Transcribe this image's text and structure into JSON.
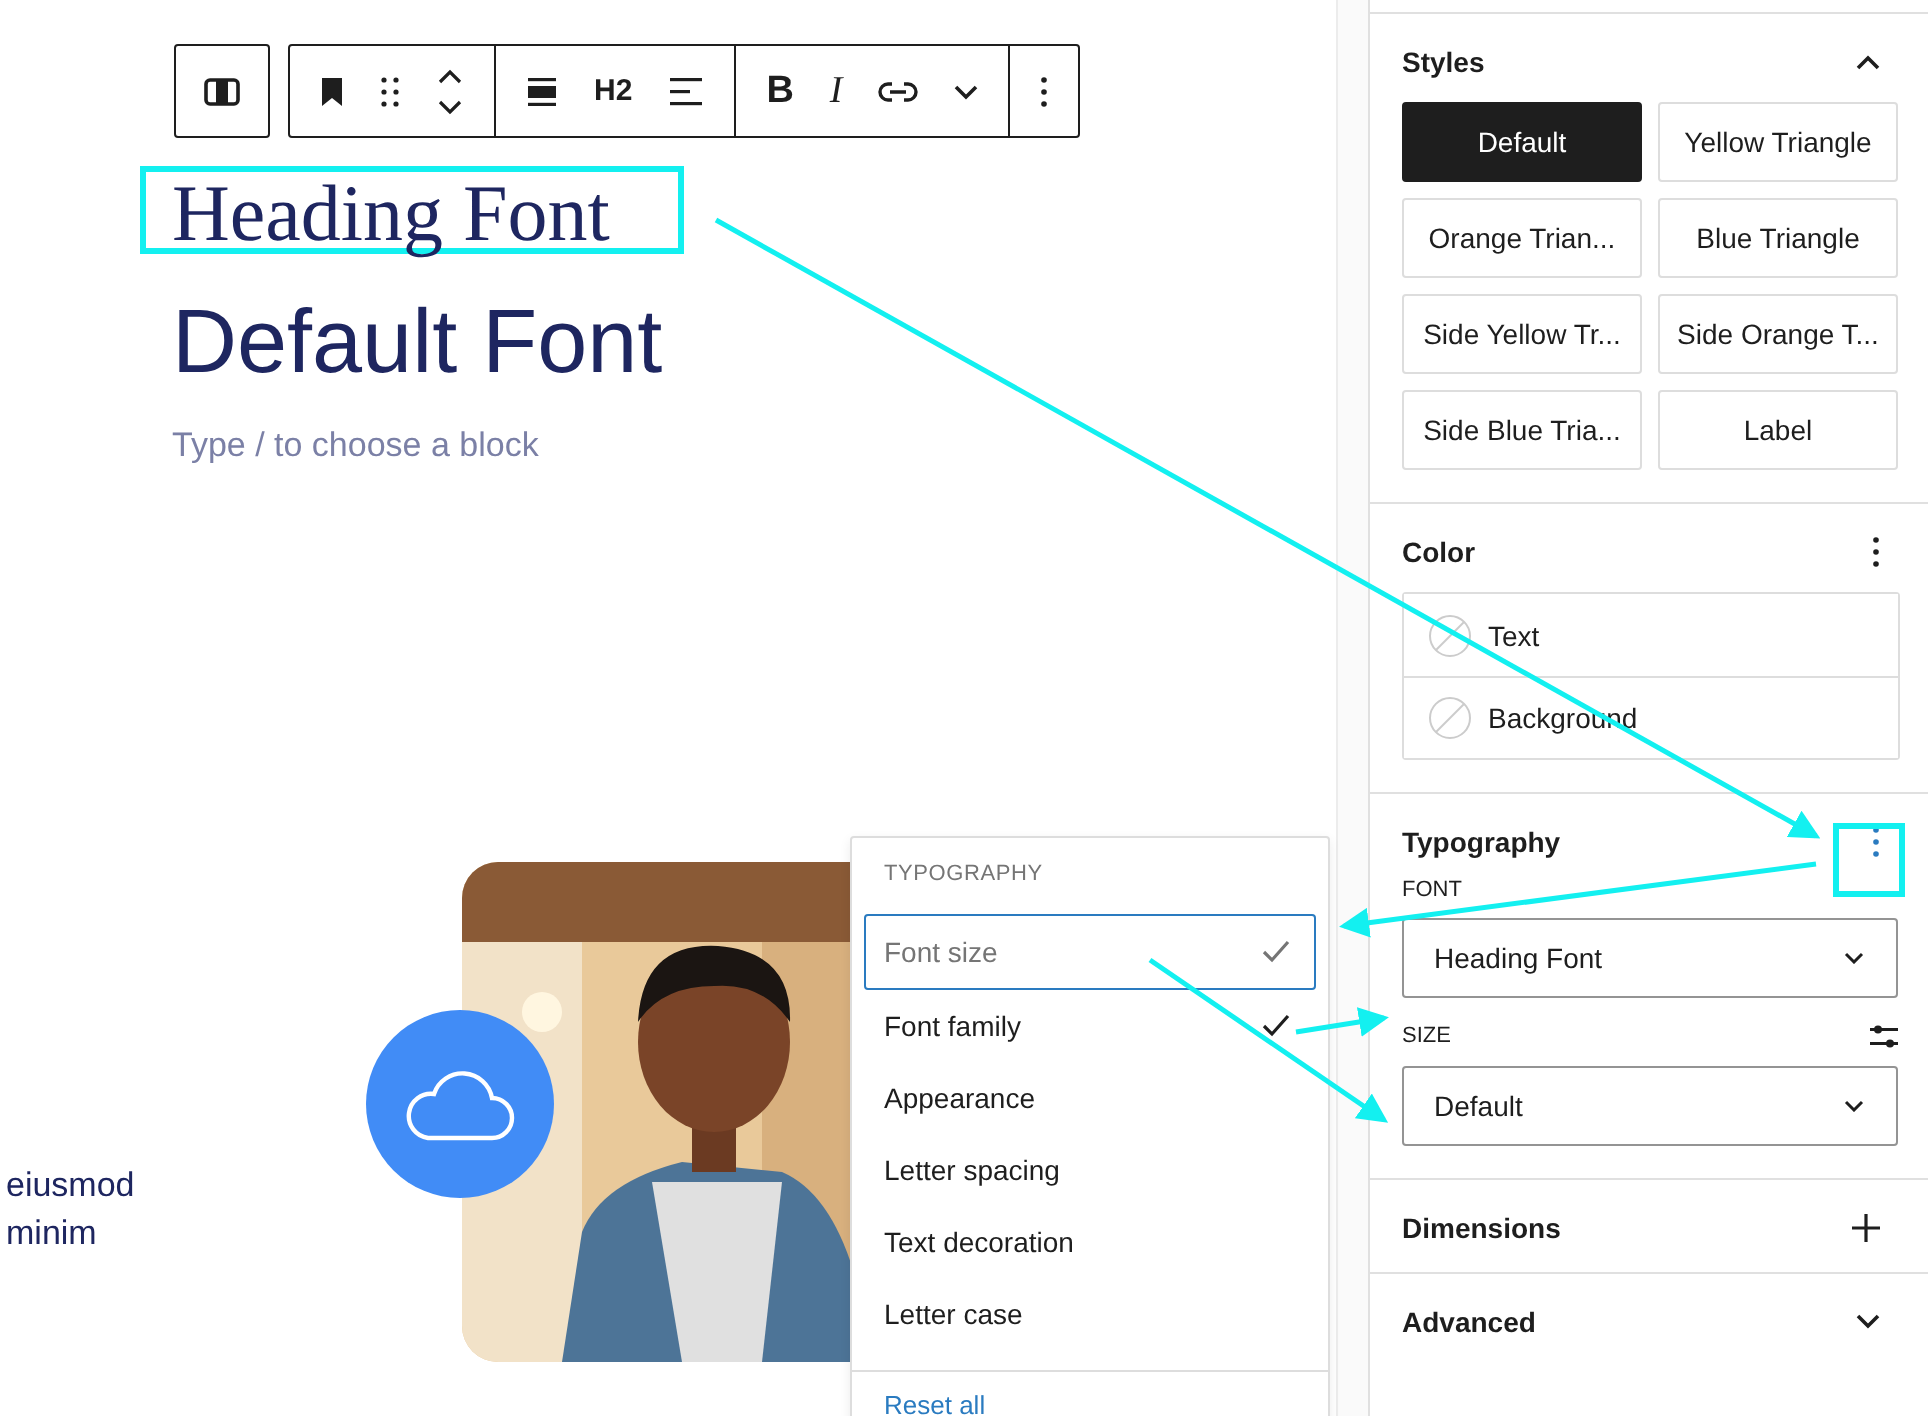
{
  "editor": {
    "toolbar": {
      "heading_level": "H2",
      "bold": "B",
      "italic": "I"
    },
    "heading": "Heading Font",
    "subheading": "Default Font",
    "placeholder": "Type / to choose a block",
    "side_text": [
      "eiusmod",
      "minim"
    ]
  },
  "menu": {
    "title": "TYPOGRAPHY",
    "items": [
      {
        "label": "Font size",
        "checked": true,
        "selected": true
      },
      {
        "label": "Font family",
        "checked": true,
        "selected": false
      },
      {
        "label": "Appearance",
        "checked": false,
        "selected": false
      },
      {
        "label": "Letter spacing",
        "checked": false,
        "selected": false
      },
      {
        "label": "Text decoration",
        "checked": false,
        "selected": false
      },
      {
        "label": "Letter case",
        "checked": false,
        "selected": false
      }
    ],
    "reset": "Reset all"
  },
  "sidebar": {
    "styles": {
      "title": "Styles",
      "options": [
        {
          "label": "Default",
          "selected": true
        },
        {
          "label": "Yellow Triangle",
          "selected": false
        },
        {
          "label": "Orange Trian...",
          "selected": false
        },
        {
          "label": "Blue Triangle",
          "selected": false
        },
        {
          "label": "Side Yellow Tr...",
          "selected": false
        },
        {
          "label": "Side Orange T...",
          "selected": false
        },
        {
          "label": "Side Blue Tria...",
          "selected": false
        },
        {
          "label": "Label",
          "selected": false
        }
      ]
    },
    "color": {
      "title": "Color",
      "items": [
        "Text",
        "Background"
      ]
    },
    "typography": {
      "title": "Typography",
      "font_label": "FONT",
      "font": "Heading Font",
      "size_label": "SIZE",
      "size": "Default"
    },
    "dimensions": "Dimensions",
    "advanced": "Advanced"
  }
}
